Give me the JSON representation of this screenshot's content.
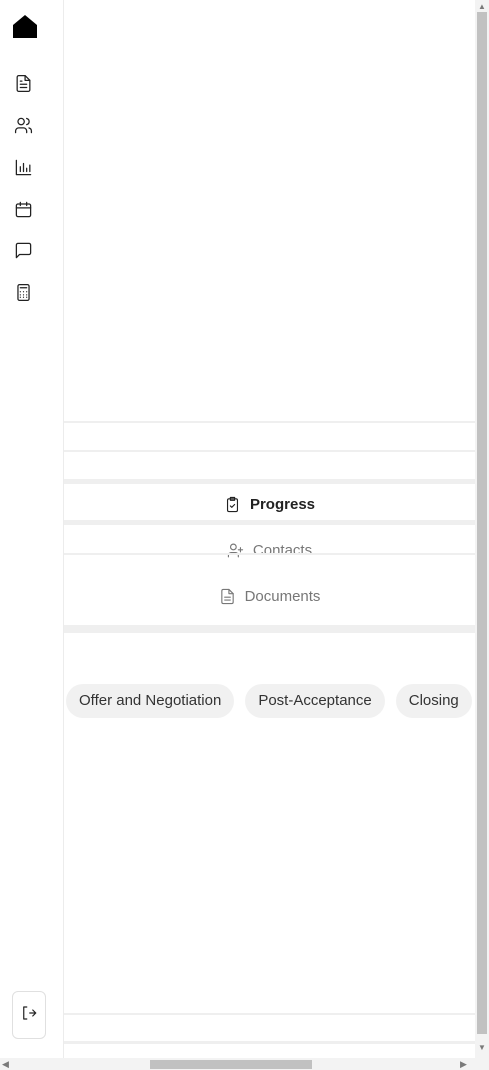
{
  "sidebar": {
    "logo_icon": "home-icon",
    "items": [
      {
        "name": "documents",
        "icon": "file-text-icon"
      },
      {
        "name": "contacts",
        "icon": "users-icon"
      },
      {
        "name": "analytics",
        "icon": "bar-chart-icon"
      },
      {
        "name": "calendar",
        "icon": "calendar-icon"
      },
      {
        "name": "messages",
        "icon": "message-square-icon"
      },
      {
        "name": "calculator",
        "icon": "calculator-icon"
      }
    ],
    "logout_icon": "log-out-icon"
  },
  "tabs": [
    {
      "label": "Progress",
      "icon": "clipboard-check-icon",
      "active": true
    },
    {
      "label": "Contacts",
      "icon": "user-plus-icon",
      "active": false
    },
    {
      "label": "Documents",
      "icon": "file-text-icon",
      "active": false
    }
  ],
  "stages": [
    "Offer and Negotiation",
    "Post-Acceptance",
    "Closing"
  ],
  "colors": {
    "active_text": "#222222",
    "inactive_text": "#777777",
    "chip_bg": "#f1f1f1",
    "divider": "#efefef"
  }
}
